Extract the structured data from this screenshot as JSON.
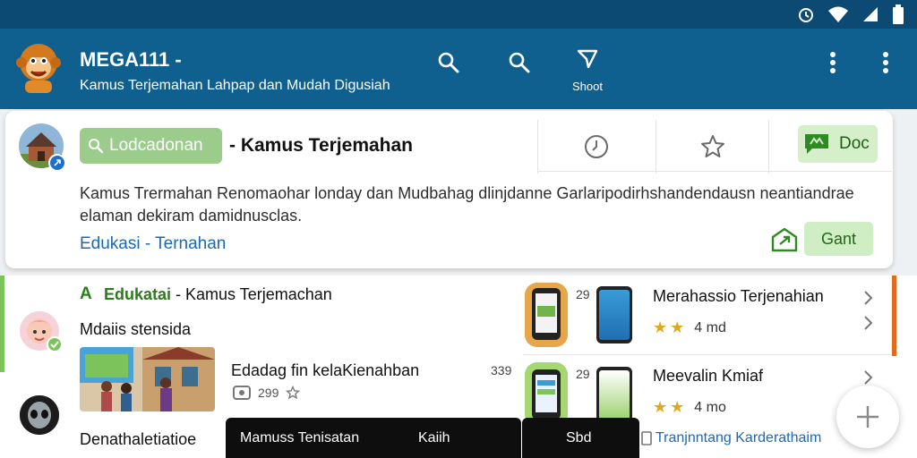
{
  "app": {
    "title": "MEGA111 -",
    "subtitle": "Kamus Terjemahan Lahpap dan Mudah Digusiah",
    "shoot_label": "Shoot"
  },
  "card": {
    "search_chip": "Lodcadonan",
    "title": "- Kamus Terjemahan",
    "doc_button": "Doc",
    "description": "Kamus Trermahan Renomaohar londay dan Mudbahag dlinjdanne Garlaripodirhshandendausn neantiandrae elaman dekiram damidnusclas.",
    "category": "Edukasi - Ternahan",
    "gant_button": "Gant"
  },
  "list": {
    "section_letter": "A",
    "section_title_a": "Edukatai",
    "section_title_b": " - Kamus Terjemachan",
    "item1_title": "Mdaiis stensida",
    "item2_title": "Edadag fin kelaKienahban",
    "item2_count": "299",
    "item3_title": "Denathaletiatioe",
    "num_left": "339"
  },
  "apps": [
    {
      "num": "29",
      "name": "Merahassio Terjenahian",
      "rating_text": "4 md"
    },
    {
      "num": "29",
      "name": "Meevalin Kmiaf",
      "rating_text": "4 mo"
    }
  ],
  "bottom": {
    "toast_text": "Mamuss Tenisatan",
    "toast_action1": "Kaiih",
    "toast_action2": "Sbd",
    "link_text": "Tranjnntang Karderathaim"
  },
  "colors": {
    "statusbar": "#0d4a73",
    "appbar": "#0f5f8f",
    "accent_green": "#9ccc8b",
    "link_blue": "#1b69b1"
  }
}
